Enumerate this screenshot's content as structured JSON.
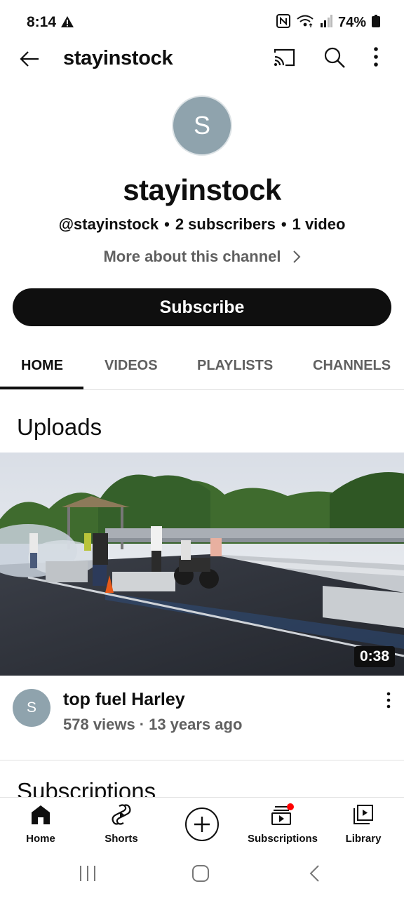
{
  "status_bar": {
    "time": "8:14",
    "battery": "74%"
  },
  "app_bar": {
    "title": "stayinstock"
  },
  "channel": {
    "avatar_letter": "S",
    "name": "stayinstock",
    "handle": "@stayinstock",
    "subscribers": "2 subscribers",
    "videos": "1 video",
    "meta_separator": "•",
    "more_about": "More about this channel",
    "subscribe_label": "Subscribe"
  },
  "tabs": [
    {
      "label": "HOME",
      "active": true
    },
    {
      "label": "VIDEOS",
      "active": false
    },
    {
      "label": "PLAYLISTS",
      "active": false
    },
    {
      "label": "CHANNELS",
      "active": false
    }
  ],
  "uploads": {
    "section_title": "Uploads",
    "video": {
      "duration": "0:38",
      "avatar_letter": "S",
      "title": "top fuel Harley",
      "views": "578 views",
      "age": "13 years ago",
      "meta_separator": "·"
    }
  },
  "subscriptions_section": {
    "title": "Subscriptions"
  },
  "bottom_nav": [
    {
      "label": "Home",
      "icon": "home-filled-icon"
    },
    {
      "label": "Shorts",
      "icon": "shorts-icon"
    },
    {
      "label": "",
      "icon": "create-plus-icon"
    },
    {
      "label": "Subscriptions",
      "icon": "subscriptions-icon"
    },
    {
      "label": "Library",
      "icon": "library-icon"
    }
  ],
  "colors": {
    "text_primary": "#0f0f0f",
    "text_secondary": "#606060",
    "avatar_bg": "#8fa3ad",
    "notification_dot": "#ff0000"
  }
}
